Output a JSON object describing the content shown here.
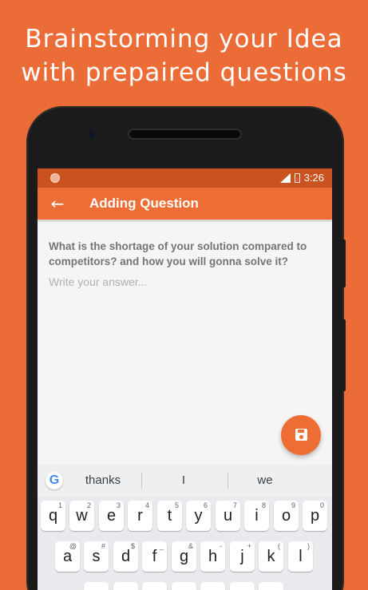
{
  "headline": {
    "line1": "Brainstorming your Idea",
    "line2": "with prepaired questions"
  },
  "status_bar": {
    "time": "3:26"
  },
  "app_bar": {
    "title": "Adding Question",
    "back_icon": "arrow-left-icon"
  },
  "content": {
    "question": "What is the shortage of your solution compared to competitors? and how you will gonna solve it?",
    "answer_value": "",
    "answer_placeholder": "Write your answer..."
  },
  "fab": {
    "icon": "save-icon"
  },
  "keyboard": {
    "logo": "G",
    "suggestions": [
      "thanks",
      "I",
      "we"
    ],
    "row1": [
      {
        "key": "q",
        "hint": "1"
      },
      {
        "key": "w",
        "hint": "2"
      },
      {
        "key": "e",
        "hint": "3"
      },
      {
        "key": "r",
        "hint": "4"
      },
      {
        "key": "t",
        "hint": "5"
      },
      {
        "key": "y",
        "hint": "6"
      },
      {
        "key": "u",
        "hint": "7"
      },
      {
        "key": "i",
        "hint": "8"
      },
      {
        "key": "o",
        "hint": "9"
      },
      {
        "key": "p",
        "hint": "0"
      }
    ],
    "row2": [
      {
        "key": "a",
        "hint": "@"
      },
      {
        "key": "s",
        "hint": "#"
      },
      {
        "key": "d",
        "hint": "$"
      },
      {
        "key": "f",
        "hint": "_"
      },
      {
        "key": "g",
        "hint": "&"
      },
      {
        "key": "h",
        "hint": "-"
      },
      {
        "key": "j",
        "hint": "+"
      },
      {
        "key": "k",
        "hint": "("
      },
      {
        "key": "l",
        "hint": ")"
      }
    ]
  },
  "colors": {
    "background": "#ec6c37",
    "app_bar": "#ee6d35",
    "status_bar": "#c9521f"
  }
}
